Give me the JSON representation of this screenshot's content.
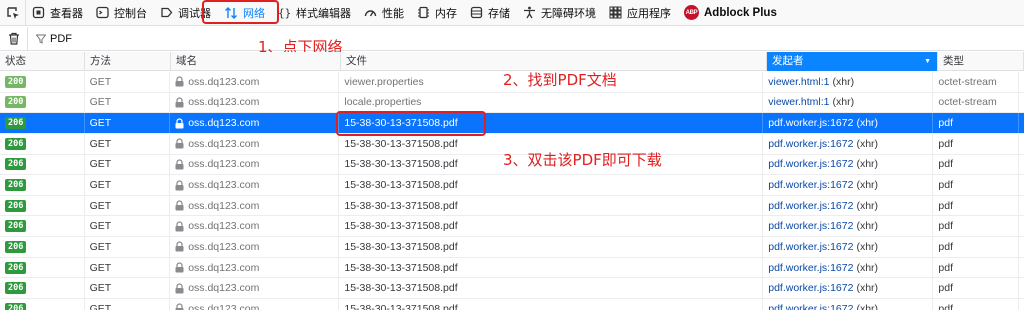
{
  "toolbar": {
    "tabs": [
      {
        "label": "查看器",
        "icon": "inspector-icon"
      },
      {
        "label": "控制台",
        "icon": "console-icon"
      },
      {
        "label": "调试器",
        "icon": "debugger-icon"
      },
      {
        "label": "网络",
        "icon": "network-icon",
        "selected": true
      },
      {
        "label": "样式编辑器",
        "icon": "style-editor-icon"
      },
      {
        "label": "性能",
        "icon": "performance-icon"
      },
      {
        "label": "内存",
        "icon": "memory-icon"
      },
      {
        "label": "存储",
        "icon": "storage-icon"
      },
      {
        "label": "无障碍环境",
        "icon": "accessibility-icon"
      },
      {
        "label": "应用程序",
        "icon": "application-icon"
      },
      {
        "label": "Adblock Plus",
        "icon": "adblock-icon",
        "badge": "ABP"
      }
    ]
  },
  "filter": {
    "value": "PDF"
  },
  "annotations": {
    "step1": "1、点下网络",
    "step2": "2、找到PDF文档",
    "step3": "3、双击该PDF即可下载"
  },
  "table": {
    "columns": {
      "status": "状态",
      "method": "方法",
      "domain": "域名",
      "file": "文件",
      "initiator": "发起者",
      "type": "类型"
    },
    "rows": [
      {
        "status": "200",
        "method": "GET",
        "domain": "oss.dq123.com",
        "file": "viewer.properties",
        "initiator": "viewer.html:1",
        "initiator_suffix": "(xhr)",
        "type": "octet-stream",
        "cached": true
      },
      {
        "status": "200",
        "method": "GET",
        "domain": "oss.dq123.com",
        "file": "locale.properties",
        "initiator": "viewer.html:1",
        "initiator_suffix": "(xhr)",
        "type": "octet-stream",
        "cached": true
      },
      {
        "status": "206",
        "method": "GET",
        "domain": "oss.dq123.com",
        "file": "15-38-30-13-371508.pdf",
        "initiator": "pdf.worker.js:1672",
        "initiator_suffix": "(xhr)",
        "type": "pdf",
        "selected": true
      },
      {
        "status": "206",
        "method": "GET",
        "domain": "oss.dq123.com",
        "file": "15-38-30-13-371508.pdf",
        "initiator": "pdf.worker.js:1672",
        "initiator_suffix": "(xhr)",
        "type": "pdf"
      },
      {
        "status": "206",
        "method": "GET",
        "domain": "oss.dq123.com",
        "file": "15-38-30-13-371508.pdf",
        "initiator": "pdf.worker.js:1672",
        "initiator_suffix": "(xhr)",
        "type": "pdf"
      },
      {
        "status": "206",
        "method": "GET",
        "domain": "oss.dq123.com",
        "file": "15-38-30-13-371508.pdf",
        "initiator": "pdf.worker.js:1672",
        "initiator_suffix": "(xhr)",
        "type": "pdf"
      },
      {
        "status": "206",
        "method": "GET",
        "domain": "oss.dq123.com",
        "file": "15-38-30-13-371508.pdf",
        "initiator": "pdf.worker.js:1672",
        "initiator_suffix": "(xhr)",
        "type": "pdf"
      },
      {
        "status": "206",
        "method": "GET",
        "domain": "oss.dq123.com",
        "file": "15-38-30-13-371508.pdf",
        "initiator": "pdf.worker.js:1672",
        "initiator_suffix": "(xhr)",
        "type": "pdf"
      },
      {
        "status": "206",
        "method": "GET",
        "domain": "oss.dq123.com",
        "file": "15-38-30-13-371508.pdf",
        "initiator": "pdf.worker.js:1672",
        "initiator_suffix": "(xhr)",
        "type": "pdf"
      },
      {
        "status": "206",
        "method": "GET",
        "domain": "oss.dq123.com",
        "file": "15-38-30-13-371508.pdf",
        "initiator": "pdf.worker.js:1672",
        "initiator_suffix": "(xhr)",
        "type": "pdf"
      },
      {
        "status": "206",
        "method": "GET",
        "domain": "oss.dq123.com",
        "file": "15-38-30-13-371508.pdf",
        "initiator": "pdf.worker.js:1672",
        "initiator_suffix": "(xhr)",
        "type": "pdf"
      },
      {
        "status": "206",
        "method": "GET",
        "domain": "oss.dq123.com",
        "file": "15-38-30-13-371508.pdf",
        "initiator": "pdf.worker.js:1672",
        "initiator_suffix": "(xhr)",
        "type": "pdf"
      }
    ]
  },
  "colors": {
    "accent": "#0a84ff",
    "selected_row": "#0a74ff",
    "annotation_red": "#e02020",
    "status_ok": "#55a640"
  }
}
